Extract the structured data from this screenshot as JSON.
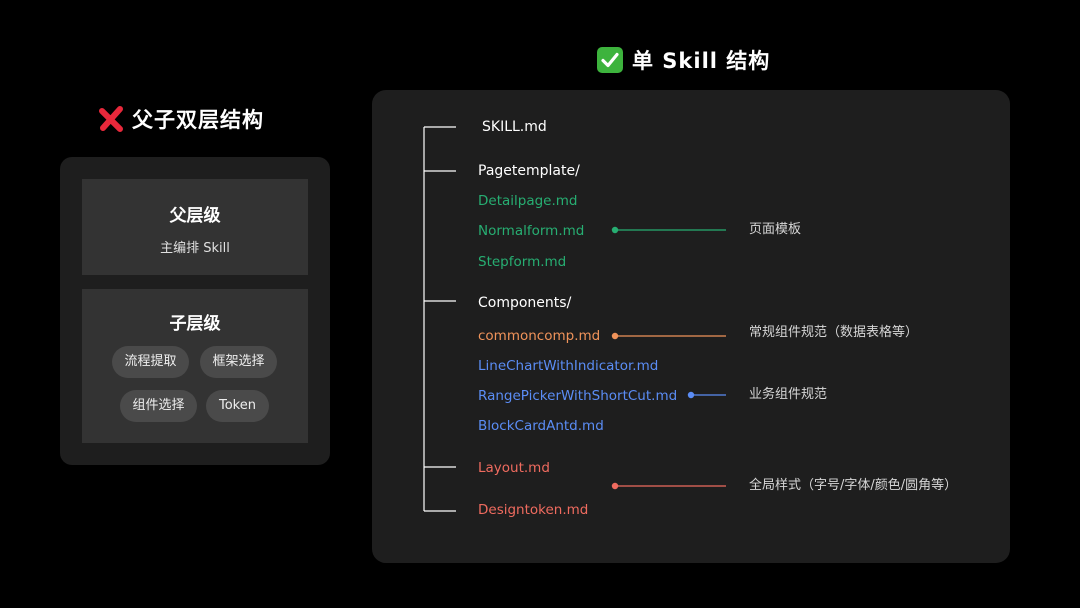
{
  "left": {
    "heading": "父子双层结构",
    "heading_icon": "cross-mark-icon",
    "parent_level": {
      "title": "父层级",
      "subtitle": "主编排 Skill"
    },
    "child_level": {
      "title": "子层级",
      "pills": [
        "流程提取",
        "框架选择",
        "组件选择",
        "Token"
      ]
    }
  },
  "right": {
    "heading": "单 Skill 结构",
    "heading_icon": "check-mark-icon",
    "tree": {
      "root_file": "SKILL.md",
      "pagetemplate": {
        "folder": "Pagetemplate/",
        "files": [
          "Detailpage.md",
          "Normalform.md",
          "Stepform.md"
        ]
      },
      "components": {
        "folder": "Components/",
        "files": [
          "commoncomp.md",
          "LineChartWithIndicator.md",
          "RangePickerWithShortCut.md",
          "BlockCardAntd.md"
        ]
      },
      "global_files": [
        "Layout.md",
        "Designtoken.md"
      ]
    },
    "annotations": {
      "page_template": "页面模板",
      "common_components": "常规组件规范（数据表格等）",
      "business_components": "业务组件规范",
      "global_styles": "全局样式（字号/字体/颜色/圆角等）"
    }
  },
  "colors": {
    "background": "#000000",
    "panel": "#1e1e1e",
    "box": "#333333",
    "pill": "#4a4a4a",
    "green": "#27ae72",
    "orange": "#f0935a",
    "blue": "#5b8df5",
    "red": "#ef6b5f",
    "cross_red": "#e8283b",
    "check_green": "#3db33d"
  }
}
